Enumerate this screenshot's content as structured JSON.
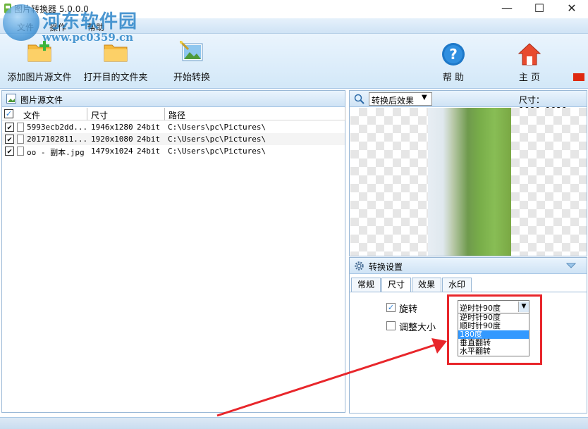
{
  "window": {
    "title": "图片转换器 5.0.0.0",
    "minimize": "—",
    "maximize": "☐",
    "close": "✕"
  },
  "watermark": {
    "text": "河东软件园",
    "url": "www.pc0359.cn"
  },
  "menu": {
    "items": [
      "文件",
      "操作",
      "帮助"
    ]
  },
  "toolbar": {
    "add_source": "添加图片源文件",
    "open_target": "打开目的文件夹",
    "start_convert": "开始转换",
    "help": "帮 助",
    "home": "主 页"
  },
  "source_panel": {
    "title": "图片源文件",
    "columns": [
      "文件",
      "尺寸",
      "路径"
    ],
    "rows": [
      {
        "file": "5993ecb2dd...",
        "size": "1946x1280",
        "depth": "24bit",
        "path": "C:\\Users\\pc\\Pictures\\",
        "checked": true
      },
      {
        "file": "2017102811...",
        "size": "1920x1080",
        "depth": "24bit",
        "path": "C:\\Users\\pc\\Pictures\\",
        "checked": true
      },
      {
        "file": "oo - 副本.jpg",
        "size": "1479x1024",
        "depth": "24bit",
        "path": "C:\\Users\\pc\\Pictures\\",
        "checked": true
      }
    ]
  },
  "preview": {
    "mode": "转换后效果",
    "size_label": "尺寸： 1080x1920"
  },
  "settings": {
    "title": "转换设置",
    "tabs": [
      "常规",
      "尺寸",
      "效果",
      "水印"
    ],
    "active_tab": "尺寸",
    "rotate_label": "旋转",
    "rotate_checked": true,
    "resize_label": "调整大小",
    "resize_checked": false,
    "rotate_value": "逆时针90度",
    "rotate_options": [
      "逆时针90度",
      "顺时针90度",
      "180度",
      "垂直翻转",
      "水平翻转"
    ],
    "rotate_selected_index": 2
  },
  "colors": {
    "accent": "#2d86c9",
    "highlight": "#e8262b",
    "selection": "#3399ff"
  }
}
